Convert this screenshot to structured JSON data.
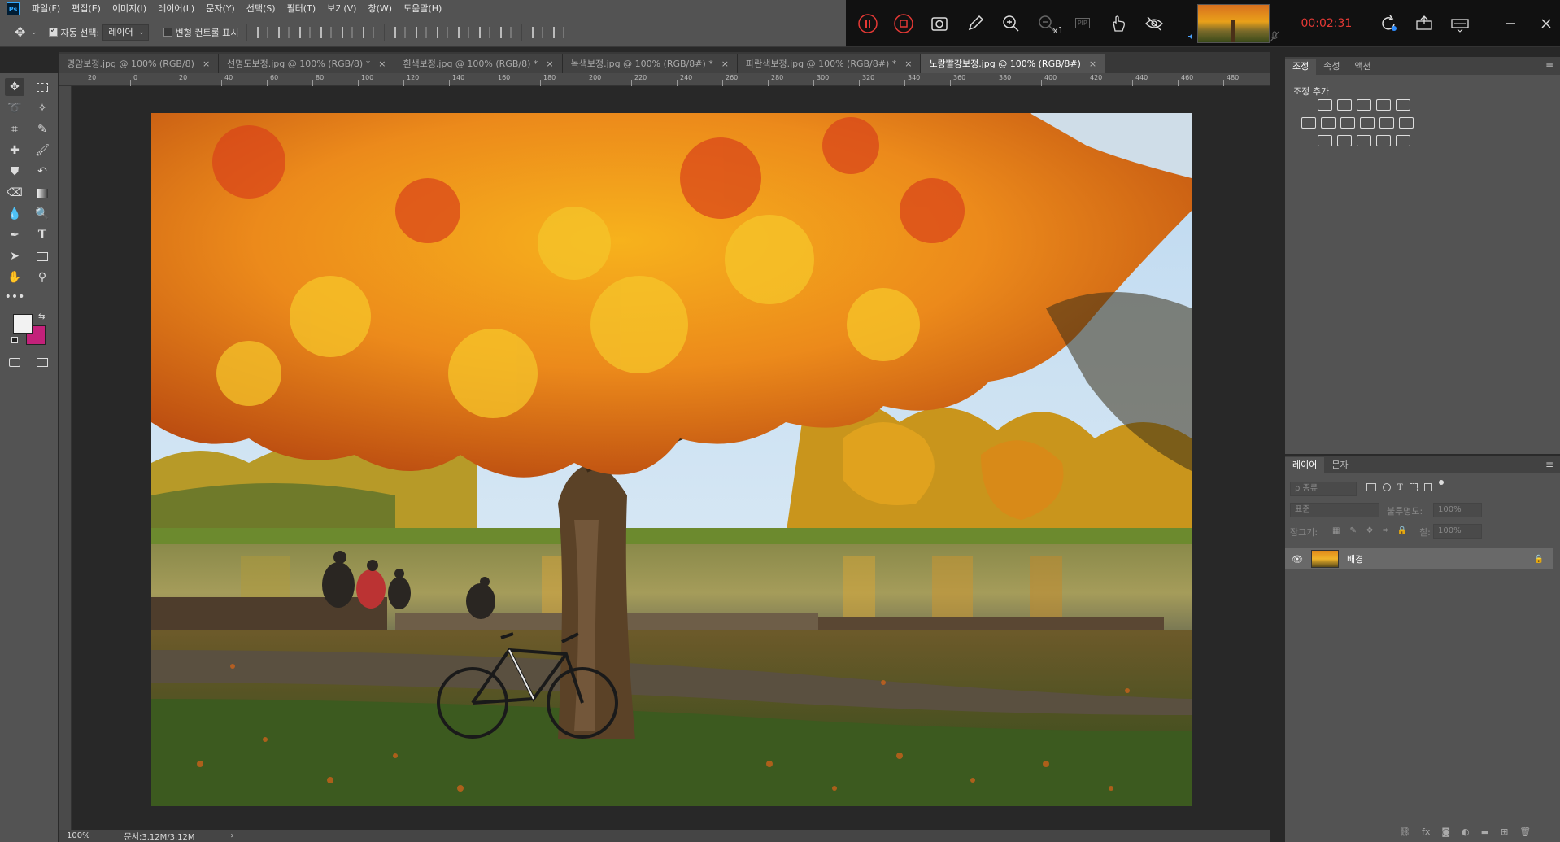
{
  "app": {
    "logo": "Ps"
  },
  "menu": [
    "파일(F)",
    "편집(E)",
    "이미지(I)",
    "레이어(L)",
    "문자(Y)",
    "선택(S)",
    "필터(T)",
    "보기(V)",
    "창(W)",
    "도움말(H)"
  ],
  "options": {
    "auto_select_label": "자동 선택:",
    "auto_select_value": "레이어",
    "transform_label": "변형 컨트롤 표시"
  },
  "recorder": {
    "time": "00:02:31",
    "zoom_label": "x1",
    "pip_label": "PIP"
  },
  "tabs": [
    {
      "label": "명암보정.jpg @ 100% (RGB/8)",
      "active": false
    },
    {
      "label": "선명도보정.jpg @ 100% (RGB/8) *",
      "active": false
    },
    {
      "label": "흰색보정.jpg @ 100% (RGB/8) *",
      "active": false
    },
    {
      "label": "녹색보정.jpg @ 100% (RGB/8#) *",
      "active": false
    },
    {
      "label": "파란색보정.jpg @ 100% (RGB/8#) *",
      "active": false
    },
    {
      "label": "노랑빨강보정.jpg @ 100% (RGB/8#)",
      "active": true
    }
  ],
  "ruler_top_labels": [
    "20",
    "0",
    "20",
    "40",
    "60",
    "80",
    "100",
    "120",
    "140",
    "160",
    "180",
    "200",
    "220",
    "240",
    "260",
    "280",
    "300",
    "320",
    "340",
    "360",
    "380",
    "400",
    "420",
    "440",
    "460",
    "480"
  ],
  "status": {
    "zoom": "100%",
    "doc": "문서:3.12M/3.12M",
    "arrow": "›"
  },
  "adjust_panel": {
    "tabs": [
      "조정",
      "속성",
      "액션"
    ],
    "add_label": "조정 추가"
  },
  "layers_panel": {
    "tabs": [
      "레이어",
      "문자"
    ],
    "filter_placeholder": "ρ 종류",
    "blend_mode": "표준",
    "opacity_label": "불투명도:",
    "opacity_value": "100%",
    "lock_label": "잠그기:",
    "fill_label": "칠:",
    "fill_value": "100%",
    "layers": [
      {
        "name": "배경",
        "visible": true,
        "locked": true
      }
    ]
  },
  "colors": {
    "foreground": "#f2f2f2",
    "background": "#c3217a",
    "rec_time": "#e53935"
  }
}
